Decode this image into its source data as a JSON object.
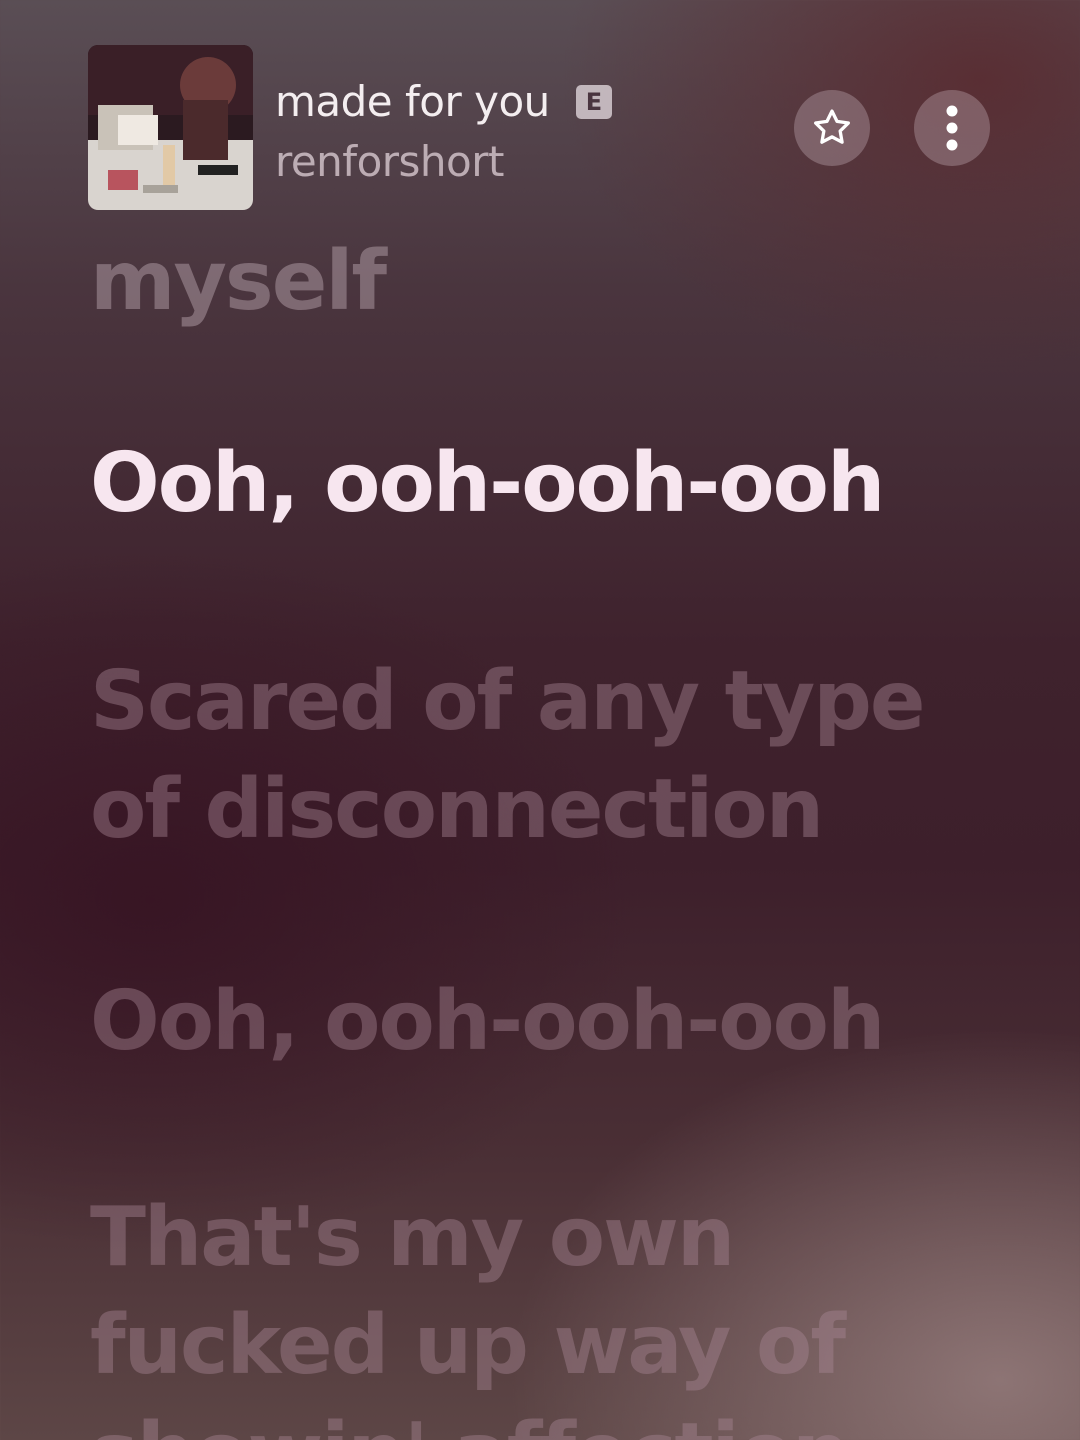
{
  "track": {
    "title": "made for you",
    "explicit_badge": "E",
    "artist": "renforshort"
  },
  "header_actions": {
    "favorite_icon": "star-outline-icon",
    "more_icon": "vertical-ellipsis-icon"
  },
  "lyrics": {
    "previous_line": "myself",
    "current_line": "Ooh, ooh-ooh-ooh",
    "next_line_1": {
      "line1": "Scared of any type",
      "line2": "of disconnection"
    },
    "next_line_2": "Ooh, ooh-ooh-ooh",
    "next_line_3": {
      "line1": "That's my own",
      "line2": "fucked up way of",
      "line3": "showin' affection"
    }
  },
  "colors": {
    "current_lyric": "#f7e6ef",
    "dim_lyric": "#aa8796"
  }
}
